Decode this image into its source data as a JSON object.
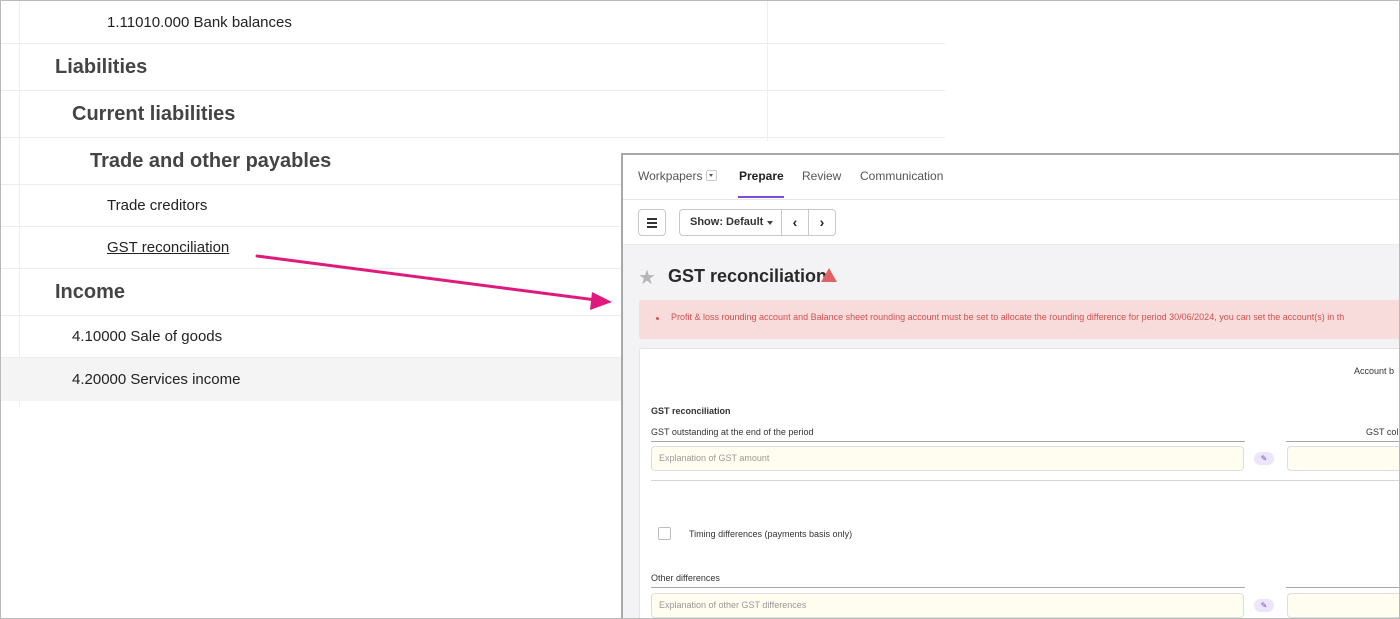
{
  "tree": {
    "rows": [
      {
        "label": "1.11010.000 Bank balances"
      },
      {
        "label": "Liabilities"
      },
      {
        "label": "Current liabilities"
      },
      {
        "label": "Trade and other payables"
      },
      {
        "label": "Trade creditors"
      },
      {
        "label": "GST reconciliation"
      },
      {
        "label": "Income"
      },
      {
        "label": "4.10000 Sale of goods"
      },
      {
        "label": "4.20000 Services income"
      }
    ]
  },
  "accent_color": "#7c4dd6",
  "arrow_color": "#e0197d",
  "panel": {
    "tabs": [
      {
        "label": "Workpapers"
      },
      {
        "label": "Prepare"
      },
      {
        "label": "Review"
      },
      {
        "label": "Communication"
      }
    ],
    "toolbar": {
      "show_label": "Show: Default",
      "prev_glyph": "‹",
      "next_glyph": "›"
    },
    "page_title": "GST reconciliation",
    "alert_message": "Profit & loss rounding account and Balance sheet rounding account must be set to allocate the rounding difference for period 30/06/2024, you can set the account(s) in th",
    "card": {
      "column_header": "Account b",
      "section_title": "GST reconciliation",
      "outstanding_label": "GST outstanding at the end of the period",
      "right_column_label": "GST col",
      "explanation_placeholder": "Explanation of GST amount",
      "timing_label": "Timing differences (payments basis only)",
      "other_label": "Other differences",
      "other_placeholder": "Explanation of other GST differences"
    }
  }
}
